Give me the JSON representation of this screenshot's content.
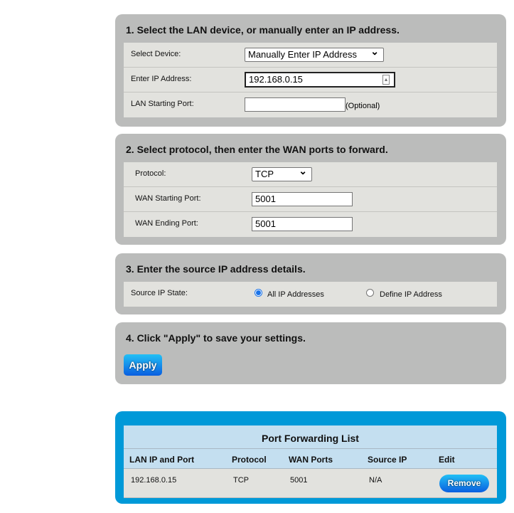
{
  "step1": {
    "title": "1. Select the LAN device, or manually enter an IP address.",
    "select_device_label": "Select Device:",
    "select_device_value": "Manually Enter IP Address",
    "ip_label": "Enter IP Address:",
    "ip_value": "192.168.0.15",
    "lan_port_label": "LAN Starting Port:",
    "lan_port_value": "",
    "optional": "(Optional)"
  },
  "step2": {
    "title": "2. Select protocol, then enter the WAN ports to forward.",
    "protocol_label": "Protocol:",
    "protocol_value": "TCP",
    "wan_start_label": "WAN Starting Port:",
    "wan_start_value": "5001",
    "wan_end_label": "WAN Ending Port:",
    "wan_end_value": "5001"
  },
  "step3": {
    "title": "3. Enter the source IP address details.",
    "source_label": "Source IP State:",
    "option_all": "All IP Addresses",
    "option_define": "Define IP Address",
    "selected": "All IP Addresses"
  },
  "step4": {
    "title": "4. Click \"Apply\" to save your settings.",
    "apply_label": "Apply"
  },
  "list": {
    "title": "Port Forwarding List",
    "headers": [
      "LAN IP and Port",
      "Protocol",
      "WAN Ports",
      "Source IP",
      "Edit"
    ],
    "rows": [
      {
        "lan": "192.168.0.15",
        "protocol": "TCP",
        "wan": "5001",
        "source": "N/A",
        "action": "Remove"
      }
    ]
  },
  "colors": {
    "panel": "#bbbcbb",
    "accent": "#0099d8",
    "button": "#0a6fe8"
  }
}
